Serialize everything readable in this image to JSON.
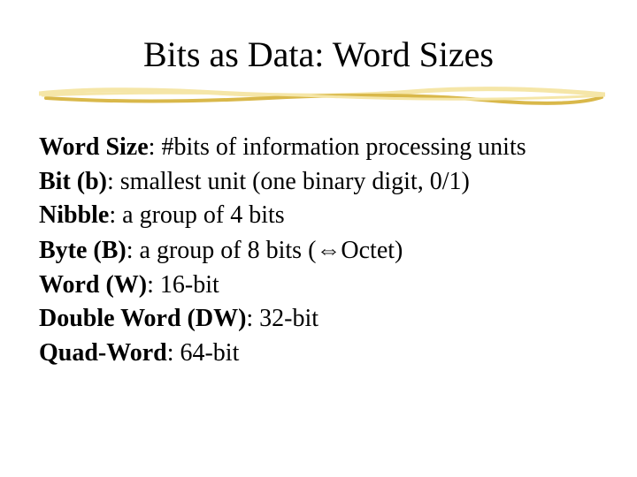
{
  "title": "Bits as Data: Word Sizes",
  "underline_colors": {
    "light": "#f5e6a8",
    "dark": "#d9b84a"
  },
  "lines": [
    {
      "term": "Word Size",
      "rest": ": #bits of information processing units"
    },
    {
      "term": "Bit (b)",
      "rest": ": smallest unit (one binary digit, 0/1)"
    },
    {
      "term": "Nibble",
      "rest": ": a group of 4 bits"
    },
    {
      "term": "Byte (B)",
      "rest": ": a group of 8 bits (",
      "arrow": "⇔",
      "rest2": "Octet)"
    },
    {
      "term": "Word (W)",
      "rest": ": 16-bit"
    },
    {
      "term": "Double Word (DW)",
      "rest": ": 32-bit"
    },
    {
      "term": "Quad-Word",
      "rest": ": 64-bit"
    }
  ]
}
